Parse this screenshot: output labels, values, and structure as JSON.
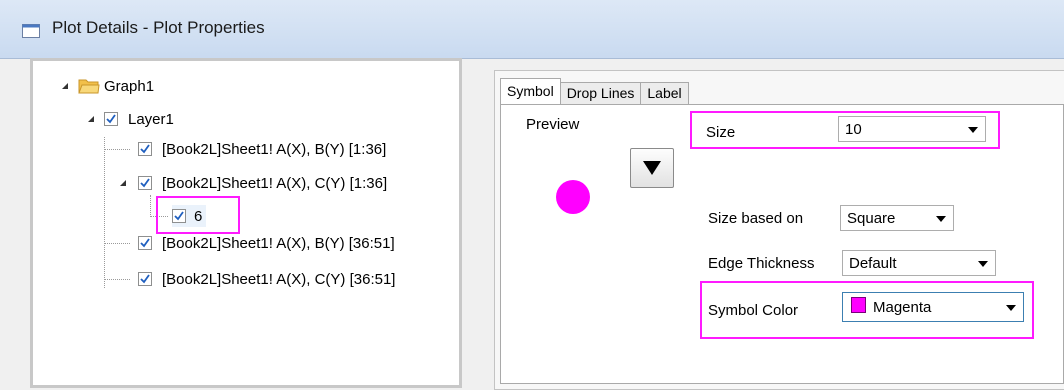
{
  "window": {
    "title": "Plot Details - Plot Properties"
  },
  "tree": {
    "graph": "Graph1",
    "layer": "Layer1",
    "plots": [
      "[Book2L]Sheet1! A(X), B(Y) [1:36]",
      "[Book2L]Sheet1! A(X), C(Y) [1:36]",
      "[Book2L]Sheet1! A(X), B(Y) [36:51]",
      "[Book2L]Sheet1! A(X), C(Y) [36:51]"
    ],
    "subitem": "6"
  },
  "tabs": [
    "Symbol",
    "Drop Lines",
    "Label"
  ],
  "symbol": {
    "preview_label": "Preview",
    "size_label": "Size",
    "size_value": "10",
    "size_based_label": "Size based on",
    "size_based_value": "Square",
    "edge_label": "Edge Thickness",
    "edge_value": "Default",
    "color_label": "Symbol Color",
    "color_value": "Magenta"
  },
  "colors": {
    "symbol": "#ff00ff",
    "highlight": "#ff1aff",
    "folder": "#f2c04a"
  }
}
